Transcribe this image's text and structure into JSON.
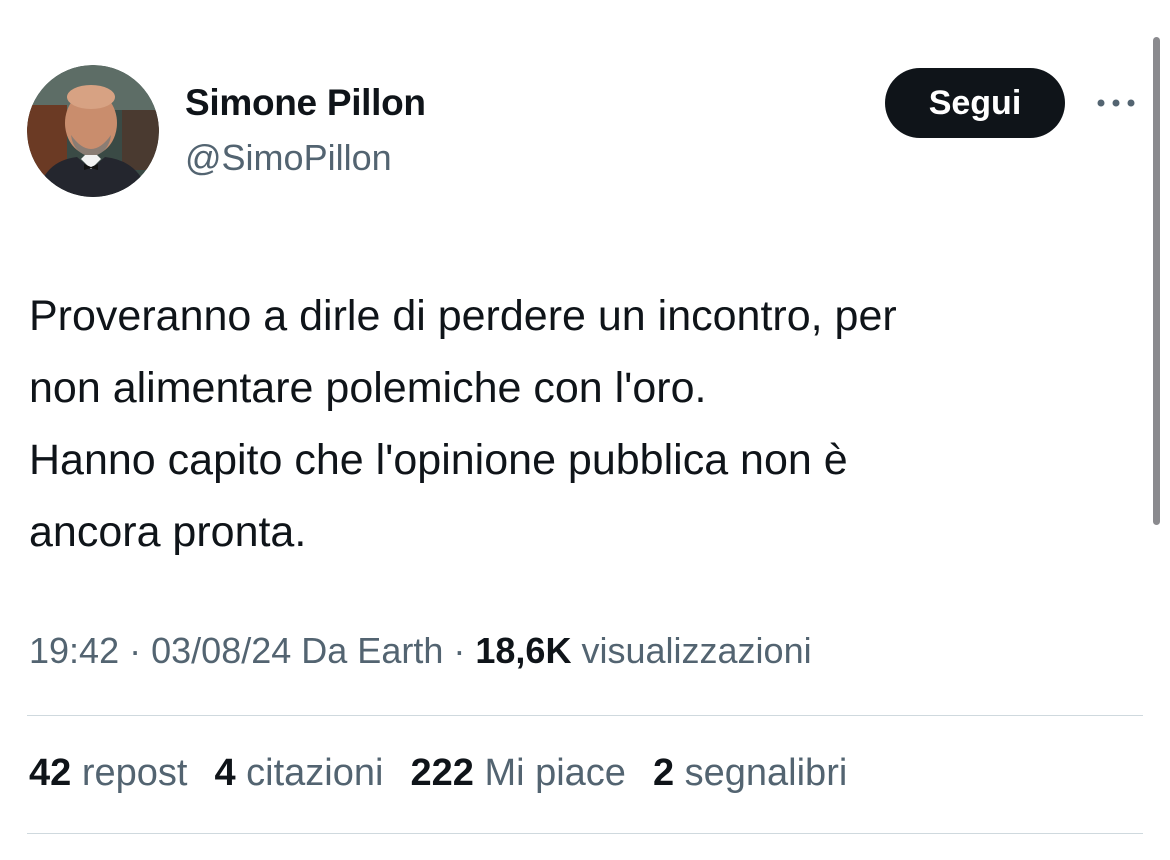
{
  "author": {
    "display_name": "Simone Pillon",
    "handle": "@SimoPillon"
  },
  "actions": {
    "follow_label": "Segui"
  },
  "tweet": {
    "text": "Proveranno a dirle di perdere un incontro, per\nnon alimentare polemiche con l'oro.\nHanno capito che l'opinione pubblica non è\nancora pronta."
  },
  "meta": {
    "time": "19:42",
    "sep1": "·",
    "date": "03/08/24",
    "source": "Da Earth",
    "sep2": "·",
    "views_count": "18,6K",
    "views_label": "visualizzazioni"
  },
  "stats": {
    "reposts": {
      "count": "42",
      "label": "repost"
    },
    "quotes": {
      "count": "4",
      "label": "citazioni"
    },
    "likes": {
      "count": "222",
      "label": "Mi piace"
    },
    "bookmarks": {
      "count": "2",
      "label": "segnalibri"
    }
  },
  "icons": {
    "more": "more-horizontal-icon"
  },
  "colors": {
    "text_primary": "#0f1419",
    "text_secondary": "#536471",
    "button_bg": "#0f1419",
    "divider": "#cfd9de"
  }
}
